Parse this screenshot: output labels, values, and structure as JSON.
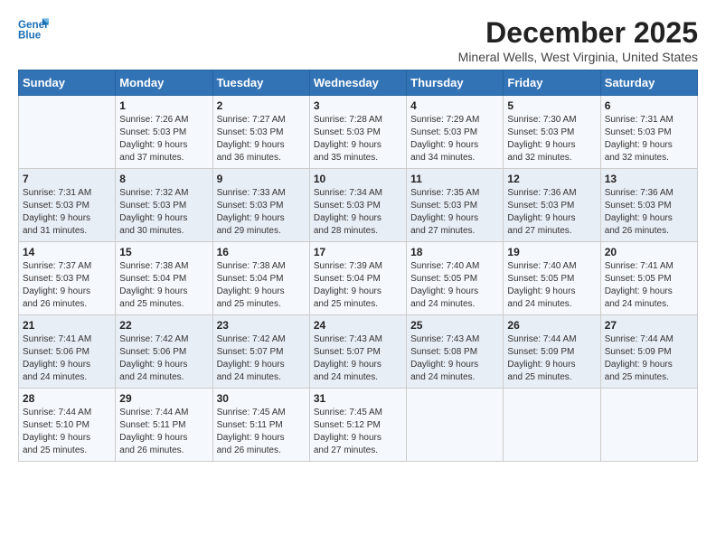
{
  "header": {
    "logo_general": "General",
    "logo_blue": "Blue",
    "month": "December 2025",
    "location": "Mineral Wells, West Virginia, United States"
  },
  "weekdays": [
    "Sunday",
    "Monday",
    "Tuesday",
    "Wednesday",
    "Thursday",
    "Friday",
    "Saturday"
  ],
  "weeks": [
    [
      {
        "day": "",
        "info": ""
      },
      {
        "day": "1",
        "info": "Sunrise: 7:26 AM\nSunset: 5:03 PM\nDaylight: 9 hours\nand 37 minutes."
      },
      {
        "day": "2",
        "info": "Sunrise: 7:27 AM\nSunset: 5:03 PM\nDaylight: 9 hours\nand 36 minutes."
      },
      {
        "day": "3",
        "info": "Sunrise: 7:28 AM\nSunset: 5:03 PM\nDaylight: 9 hours\nand 35 minutes."
      },
      {
        "day": "4",
        "info": "Sunrise: 7:29 AM\nSunset: 5:03 PM\nDaylight: 9 hours\nand 34 minutes."
      },
      {
        "day": "5",
        "info": "Sunrise: 7:30 AM\nSunset: 5:03 PM\nDaylight: 9 hours\nand 32 minutes."
      },
      {
        "day": "6",
        "info": "Sunrise: 7:31 AM\nSunset: 5:03 PM\nDaylight: 9 hours\nand 32 minutes."
      }
    ],
    [
      {
        "day": "7",
        "info": "Sunrise: 7:31 AM\nSunset: 5:03 PM\nDaylight: 9 hours\nand 31 minutes."
      },
      {
        "day": "8",
        "info": "Sunrise: 7:32 AM\nSunset: 5:03 PM\nDaylight: 9 hours\nand 30 minutes."
      },
      {
        "day": "9",
        "info": "Sunrise: 7:33 AM\nSunset: 5:03 PM\nDaylight: 9 hours\nand 29 minutes."
      },
      {
        "day": "10",
        "info": "Sunrise: 7:34 AM\nSunset: 5:03 PM\nDaylight: 9 hours\nand 28 minutes."
      },
      {
        "day": "11",
        "info": "Sunrise: 7:35 AM\nSunset: 5:03 PM\nDaylight: 9 hours\nand 27 minutes."
      },
      {
        "day": "12",
        "info": "Sunrise: 7:36 AM\nSunset: 5:03 PM\nDaylight: 9 hours\nand 27 minutes."
      },
      {
        "day": "13",
        "info": "Sunrise: 7:36 AM\nSunset: 5:03 PM\nDaylight: 9 hours\nand 26 minutes."
      }
    ],
    [
      {
        "day": "14",
        "info": "Sunrise: 7:37 AM\nSunset: 5:03 PM\nDaylight: 9 hours\nand 26 minutes."
      },
      {
        "day": "15",
        "info": "Sunrise: 7:38 AM\nSunset: 5:04 PM\nDaylight: 9 hours\nand 25 minutes."
      },
      {
        "day": "16",
        "info": "Sunrise: 7:38 AM\nSunset: 5:04 PM\nDaylight: 9 hours\nand 25 minutes."
      },
      {
        "day": "17",
        "info": "Sunrise: 7:39 AM\nSunset: 5:04 PM\nDaylight: 9 hours\nand 25 minutes."
      },
      {
        "day": "18",
        "info": "Sunrise: 7:40 AM\nSunset: 5:05 PM\nDaylight: 9 hours\nand 24 minutes."
      },
      {
        "day": "19",
        "info": "Sunrise: 7:40 AM\nSunset: 5:05 PM\nDaylight: 9 hours\nand 24 minutes."
      },
      {
        "day": "20",
        "info": "Sunrise: 7:41 AM\nSunset: 5:05 PM\nDaylight: 9 hours\nand 24 minutes."
      }
    ],
    [
      {
        "day": "21",
        "info": "Sunrise: 7:41 AM\nSunset: 5:06 PM\nDaylight: 9 hours\nand 24 minutes."
      },
      {
        "day": "22",
        "info": "Sunrise: 7:42 AM\nSunset: 5:06 PM\nDaylight: 9 hours\nand 24 minutes."
      },
      {
        "day": "23",
        "info": "Sunrise: 7:42 AM\nSunset: 5:07 PM\nDaylight: 9 hours\nand 24 minutes."
      },
      {
        "day": "24",
        "info": "Sunrise: 7:43 AM\nSunset: 5:07 PM\nDaylight: 9 hours\nand 24 minutes."
      },
      {
        "day": "25",
        "info": "Sunrise: 7:43 AM\nSunset: 5:08 PM\nDaylight: 9 hours\nand 24 minutes."
      },
      {
        "day": "26",
        "info": "Sunrise: 7:44 AM\nSunset: 5:09 PM\nDaylight: 9 hours\nand 25 minutes."
      },
      {
        "day": "27",
        "info": "Sunrise: 7:44 AM\nSunset: 5:09 PM\nDaylight: 9 hours\nand 25 minutes."
      }
    ],
    [
      {
        "day": "28",
        "info": "Sunrise: 7:44 AM\nSunset: 5:10 PM\nDaylight: 9 hours\nand 25 minutes."
      },
      {
        "day": "29",
        "info": "Sunrise: 7:44 AM\nSunset: 5:11 PM\nDaylight: 9 hours\nand 26 minutes."
      },
      {
        "day": "30",
        "info": "Sunrise: 7:45 AM\nSunset: 5:11 PM\nDaylight: 9 hours\nand 26 minutes."
      },
      {
        "day": "31",
        "info": "Sunrise: 7:45 AM\nSunset: 5:12 PM\nDaylight: 9 hours\nand 27 minutes."
      },
      {
        "day": "",
        "info": ""
      },
      {
        "day": "",
        "info": ""
      },
      {
        "day": "",
        "info": ""
      }
    ]
  ]
}
